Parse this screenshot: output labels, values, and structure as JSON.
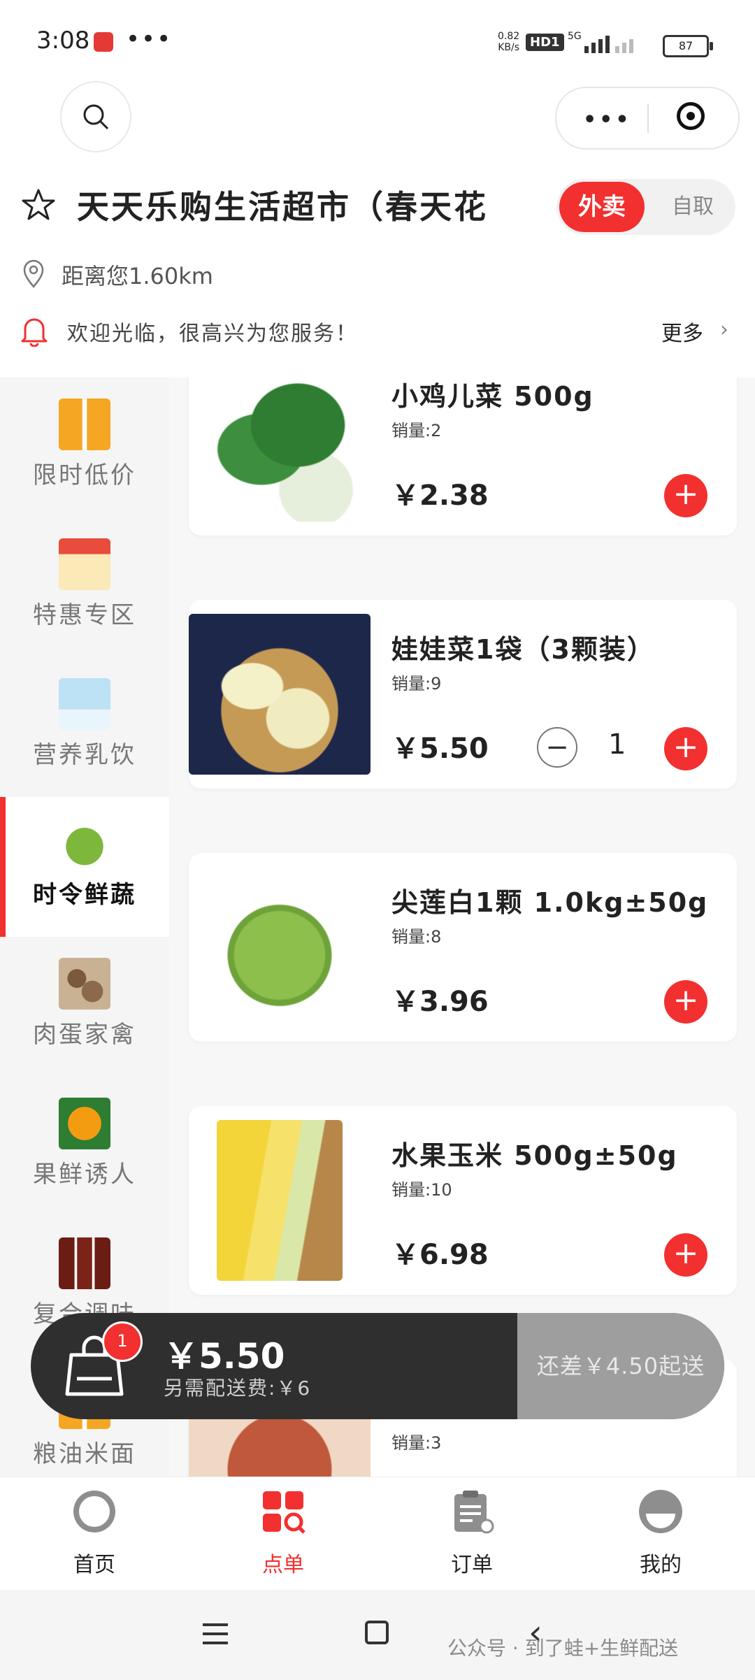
{
  "status_bar": {
    "time": "3:08",
    "dots": "•••",
    "net_speed_value": "0.82",
    "net_speed_unit": "KB/s",
    "hd_label": "HD1",
    "network": "5G",
    "battery": "87"
  },
  "header": {
    "shop_name": "天天乐购生活超市（春天花",
    "mode_delivery": "外卖",
    "mode_pickup": "自取",
    "distance": "距离您1.60km",
    "notice": "欢迎光临，很高兴为您服务！",
    "notice_more": "更多",
    "capsule_more": "•••"
  },
  "sidebar": {
    "items": [
      {
        "label": "限时低价"
      },
      {
        "label": "特惠专区"
      },
      {
        "label": "营养乳饮"
      },
      {
        "label": "时令鲜蔬"
      },
      {
        "label": "肉蛋家禽"
      },
      {
        "label": "果鲜诱人"
      },
      {
        "label": "复合调味"
      },
      {
        "label": "粮油米面"
      }
    ]
  },
  "products": [
    {
      "name": "小鸡儿菜 500g",
      "sales": "销量:2",
      "price": "￥2.38"
    },
    {
      "name": "娃娃菜1袋（3颗装）",
      "sales": "销量:9",
      "price": "￥5.50",
      "qty": "1"
    },
    {
      "name": "尖莲白1颗 1.0kg±50g",
      "sales": "销量:8",
      "price": "￥3.96"
    },
    {
      "name": "水果玉米 500g±50g",
      "sales": "销量:10",
      "price": "￥6.98"
    },
    {
      "name": "",
      "sales": "销量:3",
      "price": ""
    }
  ],
  "cart": {
    "badge": "1",
    "total": "￥5.50",
    "fee": "另需配送费:￥6",
    "checkout": "还差￥4.50起送"
  },
  "tabbar": {
    "items": [
      {
        "label": "首页"
      },
      {
        "label": "点单"
      },
      {
        "label": "订单"
      },
      {
        "label": "我的"
      }
    ]
  },
  "watermark": "公众号 · 到了蛙+生鲜配送",
  "colors": {
    "accent": "#f2302f",
    "cart_bg": "#2f2f2f",
    "cart_disabled": "#9e9e9e"
  }
}
